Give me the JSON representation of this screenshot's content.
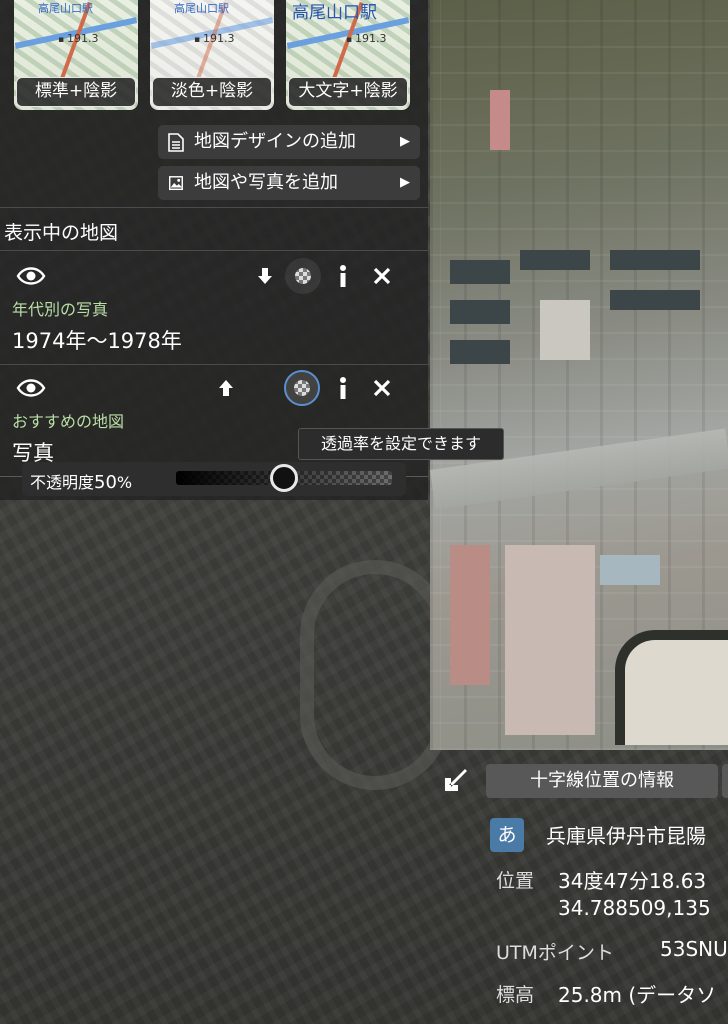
{
  "thumbnails": [
    {
      "label": "標準+陰影",
      "station": "高尾山口駅",
      "elevation": "191.3",
      "style": "standard"
    },
    {
      "label": "淡色+陰影",
      "station": "高尾山口駅",
      "elevation": "191.3",
      "style": "pale"
    },
    {
      "label": "大文字+陰影",
      "station": "高尾山口駅",
      "elevation": "191.3",
      "style": "large"
    }
  ],
  "actions": {
    "add_design": "地図デザインの追加",
    "add_map_photo": "地図や写真を追加"
  },
  "section_title": "表示中の地図",
  "layers": [
    {
      "type": "年代別の写真",
      "name": "1974年〜1978年"
    },
    {
      "type": "おすすめの地図",
      "name": "写真"
    }
  ],
  "tooltip": "透過率を設定できます",
  "opacity": {
    "label": "不透明度",
    "value": "50",
    "unit": "%",
    "fraction": 0.5
  },
  "crosshair": {
    "button_label": "十字線位置の情報",
    "addr_badge": "あ",
    "address": "兵庫県伊丹市昆陽",
    "position_label": "位置",
    "position_dms": "34度47分18.63",
    "position_decimal": "34.788509,135",
    "utm_label": "UTMポイント",
    "utm_value": "53SNU",
    "elev_label": "標高",
    "elev_value": "25.8m (データソ"
  },
  "colors": {
    "accent": "#5c8fd0",
    "badge": "#4a7ba7",
    "layer_type": "#b9dfa6"
  }
}
